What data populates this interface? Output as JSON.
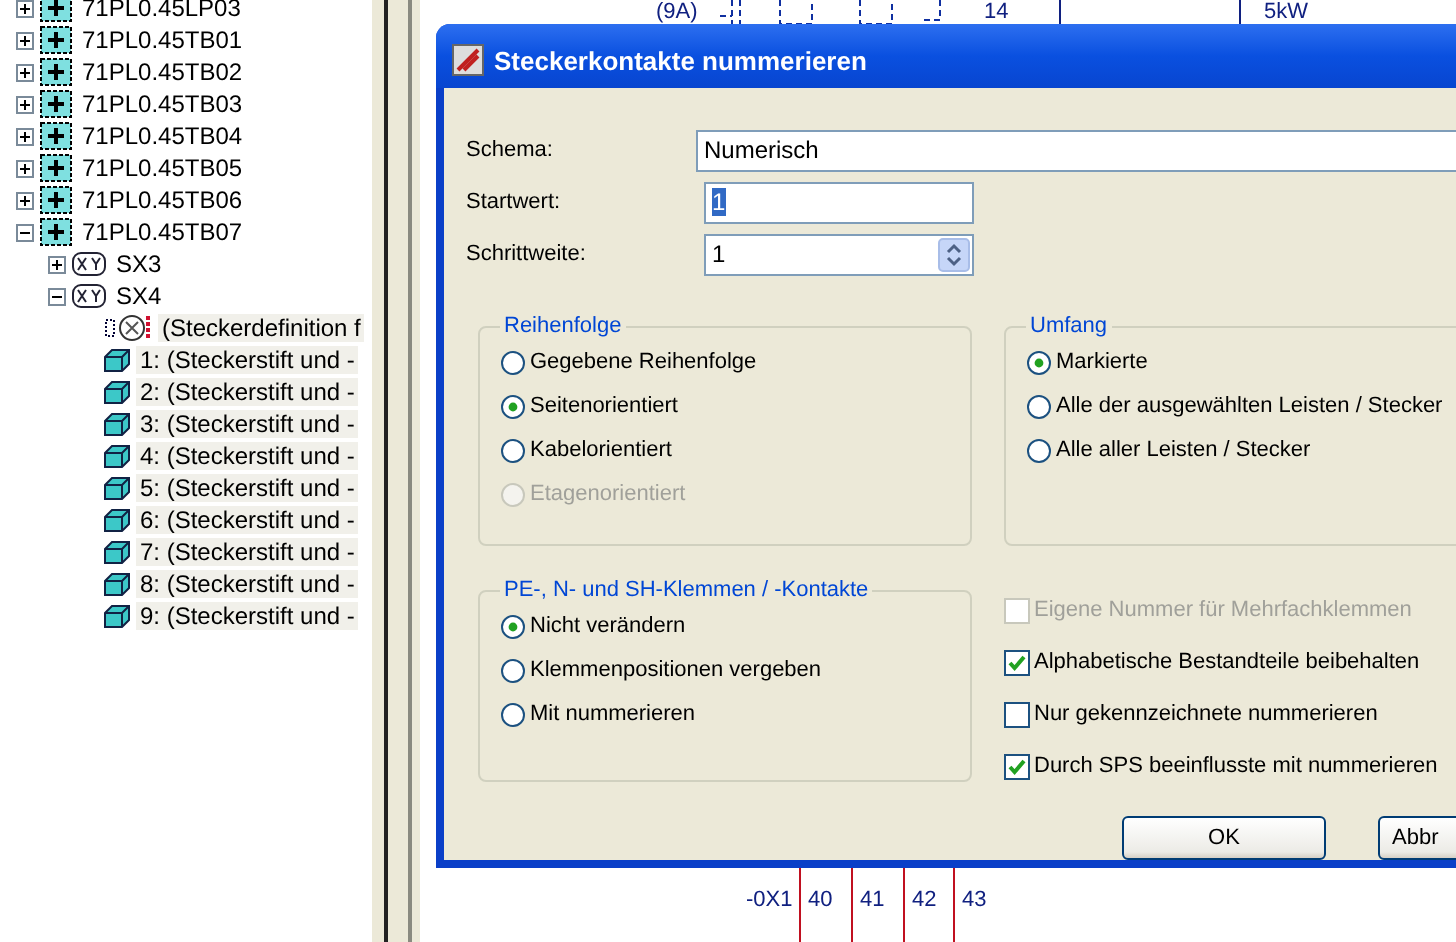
{
  "tree": [
    {
      "label": "71PL0.45LP03",
      "kind": "strip",
      "expanded": false
    },
    {
      "label": "71PL0.45TB01",
      "kind": "strip",
      "expanded": false
    },
    {
      "label": "71PL0.45TB02",
      "kind": "strip",
      "expanded": false
    },
    {
      "label": "71PL0.45TB03",
      "kind": "strip",
      "expanded": false
    },
    {
      "label": "71PL0.45TB04",
      "kind": "strip",
      "expanded": false
    },
    {
      "label": "71PL0.45TB05",
      "kind": "strip",
      "expanded": false
    },
    {
      "label": "71PL0.45TB06",
      "kind": "strip",
      "expanded": false
    },
    {
      "label": "71PL0.45TB07",
      "kind": "strip",
      "expanded": true,
      "children": [
        {
          "label": "SX3",
          "kind": "plug",
          "expanded": false
        },
        {
          "label": "SX4",
          "kind": "plug",
          "expanded": true,
          "children": [
            {
              "label": "(Steckerdefinition f",
              "kind": "definition"
            },
            {
              "label": "1: (Steckerstift und -",
              "kind": "pin"
            },
            {
              "label": "2: (Steckerstift und -",
              "kind": "pin"
            },
            {
              "label": "3: (Steckerstift und -",
              "kind": "pin"
            },
            {
              "label": "4: (Steckerstift und -",
              "kind": "pin"
            },
            {
              "label": "5: (Steckerstift und -",
              "kind": "pin"
            },
            {
              "label": "6: (Steckerstift und -",
              "kind": "pin"
            },
            {
              "label": "7: (Steckerstift und -",
              "kind": "pin"
            },
            {
              "label": "8: (Steckerstift und -",
              "kind": "pin"
            },
            {
              "label": "9: (Steckerstift und -",
              "kind": "pin"
            }
          ]
        }
      ]
    }
  ],
  "schematic": {
    "top_labels": [
      "(9A)",
      "14",
      "5kW"
    ],
    "terminal_strip": "-0X1",
    "terminals": [
      "40",
      "41",
      "42",
      "43"
    ]
  },
  "dialog": {
    "title": "Steckerkontakte nummerieren",
    "schema": {
      "label": "Schema:",
      "value": "Numerisch"
    },
    "start": {
      "label": "Startwert:",
      "value": "1",
      "highlighted": true
    },
    "step": {
      "label": "Schrittweite:",
      "value": "1"
    },
    "groups": [
      {
        "title": "Reihenfolge",
        "options": [
          {
            "label": "Gegebene Reihenfolge",
            "selected": false,
            "disabled": false
          },
          {
            "label": "Seitenorientiert",
            "selected": true,
            "disabled": false
          },
          {
            "label": "Kabelorientiert",
            "selected": false,
            "disabled": false
          },
          {
            "label": "Etagenorientiert",
            "selected": false,
            "disabled": true
          }
        ]
      },
      {
        "title": "Umfang",
        "options": [
          {
            "label": "Markierte",
            "selected": true,
            "disabled": false
          },
          {
            "label": "Alle der ausgewählten Leisten / Stecker",
            "selected": false,
            "disabled": false
          },
          {
            "label": "Alle aller Leisten / Stecker",
            "selected": false,
            "disabled": false
          }
        ]
      },
      {
        "title": "PE-, N- und SH-Klemmen / -Kontakte",
        "options": [
          {
            "label": "Nicht verändern",
            "selected": true,
            "disabled": false
          },
          {
            "label": "Klemmenpositionen vergeben",
            "selected": false,
            "disabled": false
          },
          {
            "label": "Mit nummerieren",
            "selected": false,
            "disabled": false
          }
        ]
      }
    ],
    "checkboxes": [
      {
        "label": "Eigene Nummer für Mehrfachklemmen",
        "checked": false,
        "disabled": true
      },
      {
        "label": "Alphabetische Bestandteile beibehalten",
        "checked": true,
        "disabled": false
      },
      {
        "label": "Nur gekennzeichnete nummerieren",
        "checked": false,
        "disabled": false
      },
      {
        "label": "Durch SPS beeinflusste mit nummerieren",
        "checked": true,
        "disabled": false
      }
    ],
    "buttons": [
      "OK",
      "Abbr"
    ]
  }
}
